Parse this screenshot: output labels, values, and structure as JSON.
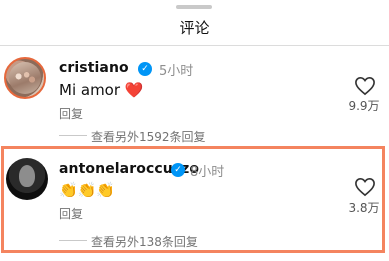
{
  "sheet": {
    "title": "评论"
  },
  "comments": [
    {
      "username": "cristiano",
      "time": "5小时",
      "text": "Mi amor ❤️",
      "reply_label": "回复",
      "like_count": "9.9万",
      "view_replies": "查看另外1592条回复"
    },
    {
      "username": "antonelaroccuzzo",
      "time": "8小时",
      "text": "👏👏👏",
      "reply_label": "回复",
      "like_count": "3.8万",
      "view_replies": "查看另外138条回复"
    }
  ],
  "colors": {
    "verified": "#0095f6",
    "highlight": "#f4845f",
    "heart_emoji": "#e0245e"
  },
  "icons": {
    "verified": "verified-badge-icon",
    "like": "heart-outline-icon"
  }
}
